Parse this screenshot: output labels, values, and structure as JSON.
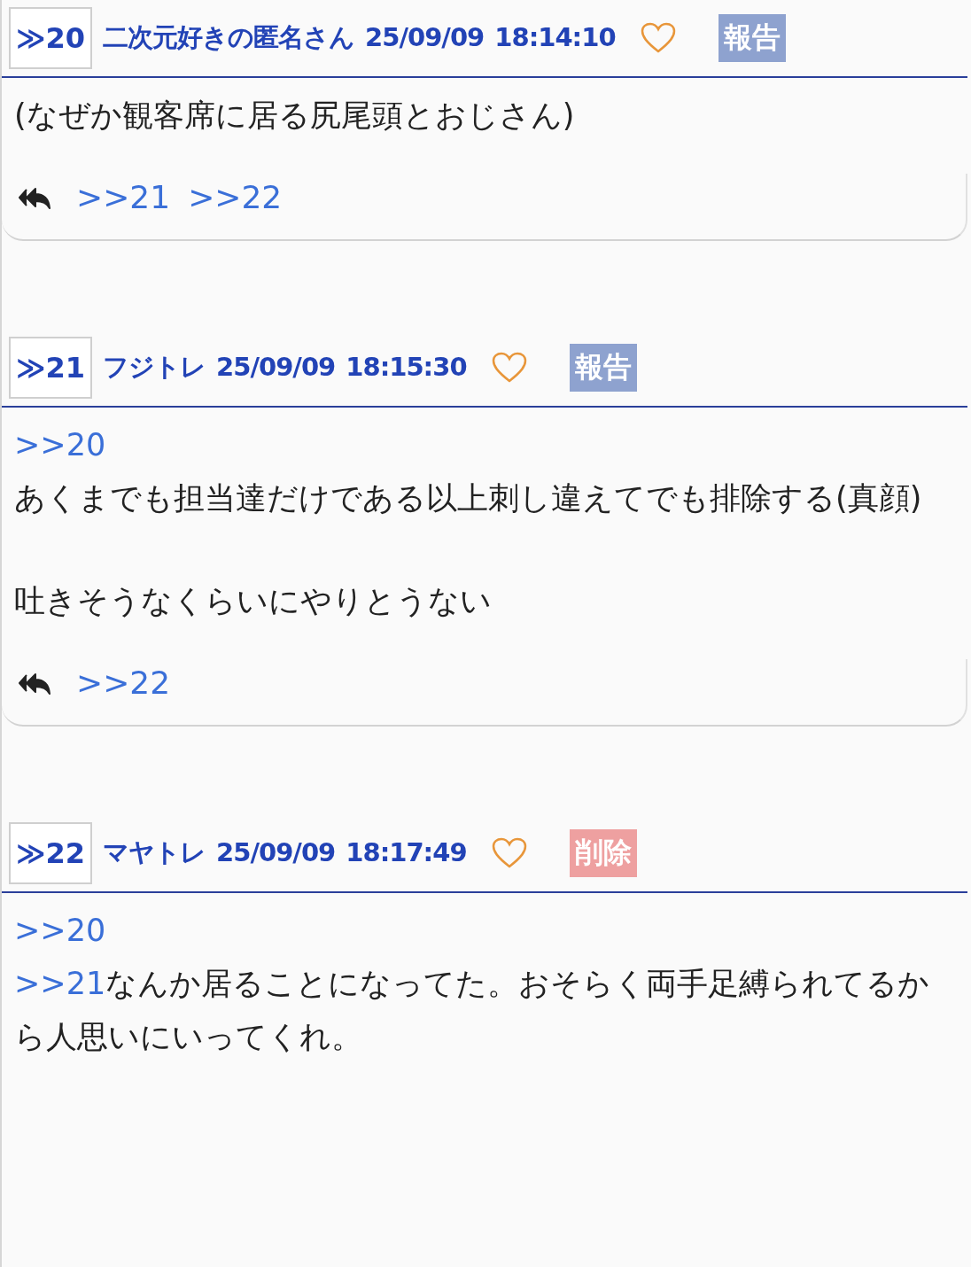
{
  "posts": [
    {
      "number": "≫20",
      "author": "二次元好きの匿名さん",
      "date": "25/09/09",
      "time": "18:14:10",
      "liked": false,
      "action": {
        "kind": "report",
        "label": "報告"
      },
      "paragraphs": [
        [
          [
            {
              "kind": "text",
              "text": "(なぜか観客席に居る尻尾頭とおじさん)"
            }
          ]
        ]
      ],
      "replies": [
        ">>21",
        ">>22"
      ]
    },
    {
      "number": "≫21",
      "author": "フジトレ",
      "date": "25/09/09",
      "time": "18:15:30",
      "liked": false,
      "action": {
        "kind": "report",
        "label": "報告"
      },
      "paragraphs": [
        [
          [
            {
              "kind": "anchor",
              "text": ">>20"
            }
          ],
          [
            {
              "kind": "text",
              "text": "あくまでも担当達だけである以上刺し違えてでも排除する(真顔)"
            }
          ]
        ],
        [
          [
            {
              "kind": "text",
              "text": "吐きそうなくらいにやりとうない"
            }
          ]
        ]
      ],
      "replies": [
        ">>22"
      ]
    },
    {
      "number": "≫22",
      "author": "マヤトレ",
      "date": "25/09/09",
      "time": "18:17:49",
      "liked": false,
      "action": {
        "kind": "delete",
        "label": "削除"
      },
      "paragraphs": [
        [
          [
            {
              "kind": "anchor",
              "text": ">>20"
            }
          ],
          [
            {
              "kind": "anchor",
              "text": ">>21"
            },
            {
              "kind": "text",
              "text": "なんか居ることになってた。おそらく両手足縛られてるから人思いにいってくれ。"
            }
          ]
        ]
      ]
    }
  ]
}
